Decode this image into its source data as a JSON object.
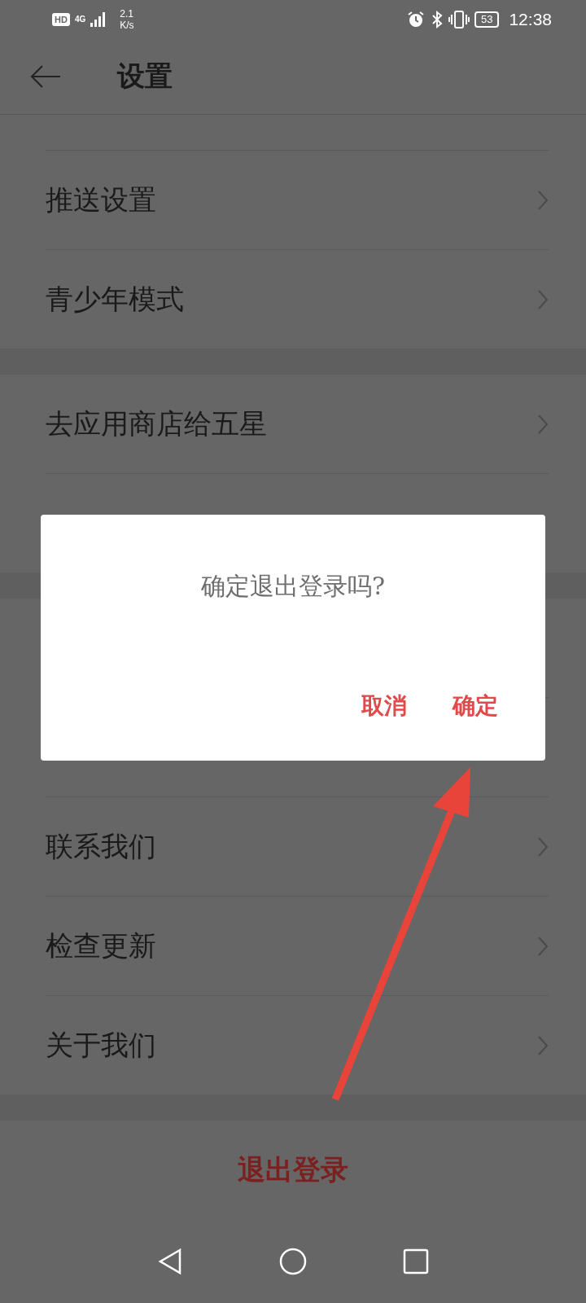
{
  "status_bar": {
    "hd": "HD",
    "network": "4G",
    "speed": "2.1",
    "speed_unit": "K/s",
    "battery": "53",
    "time": "12:38"
  },
  "header": {
    "title": "设置"
  },
  "sections": [
    {
      "items": [
        {
          "kind": "cut"
        },
        {
          "kind": "link",
          "label": "推送设置"
        },
        {
          "kind": "link",
          "label": "青少年模式"
        }
      ]
    },
    {
      "items": [
        {
          "kind": "link",
          "label": "去应用商店给五星"
        },
        {
          "kind": "obscured"
        }
      ]
    },
    {
      "items": [
        {
          "kind": "obscured"
        },
        {
          "kind": "obscured"
        },
        {
          "kind": "link",
          "label": "联系我们"
        },
        {
          "kind": "link",
          "label": "检查更新"
        },
        {
          "kind": "link",
          "label": "关于我们"
        }
      ]
    }
  ],
  "logout": {
    "label": "退出登录"
  },
  "dialog": {
    "message": "确定退出登录吗?",
    "buttons": [
      "取消",
      "确定"
    ]
  }
}
